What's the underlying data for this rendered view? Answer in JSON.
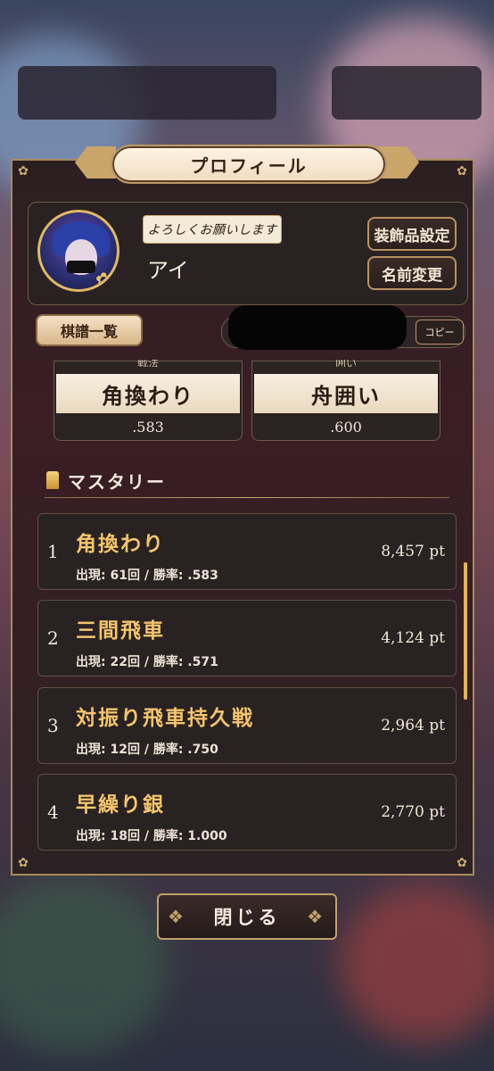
{
  "dialog": {
    "title": "プロフィール",
    "motto": "よろしくお願いします",
    "player_name": "アイ",
    "buttons": {
      "decoration": "装飾品設定",
      "rename": "名前変更",
      "kifu_list": "棋譜一覧",
      "copy": "コピー",
      "close": "閉じる"
    },
    "stats": [
      {
        "label": "戦法",
        "name": "角換わり",
        "rate": ".583"
      },
      {
        "label": "囲い",
        "name": "舟囲い",
        "rate": ".600"
      }
    ],
    "mastery": {
      "heading": "マスタリー",
      "items": [
        {
          "rank": "1",
          "name": "角換わり",
          "sub": "出現: 61回 / 勝率: .583",
          "points": "8,457 pt"
        },
        {
          "rank": "2",
          "name": "三間飛車",
          "sub": "出現: 22回 / 勝率: .571",
          "points": "4,124 pt"
        },
        {
          "rank": "3",
          "name": "対振り飛車持久戦",
          "sub": "出現: 12回 / 勝率: .750",
          "points": "2,964 pt"
        },
        {
          "rank": "4",
          "name": "早繰り銀",
          "sub": "出現: 18回 / 勝率: 1.000",
          "points": "2,770 pt"
        }
      ]
    }
  },
  "icons": {
    "mastery": "mastery-medal-icon",
    "corner": "flower-ornament-icon"
  },
  "colors": {
    "gold_accent": "#c9a56a",
    "mastery_name": "#f4c56c",
    "panel_bg": "#2b1f22",
    "scrollbar": "#e5b558"
  }
}
